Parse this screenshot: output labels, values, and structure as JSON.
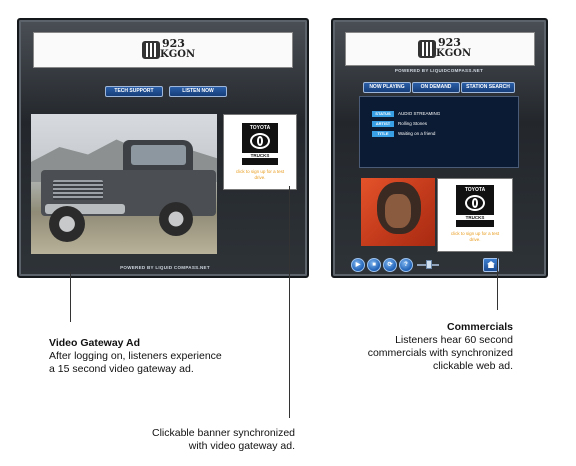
{
  "left_player": {
    "logo": {
      "number": "923",
      "name": "KGON"
    },
    "buttons": [
      "TECH SUPPORT",
      "LISTEN NOW"
    ],
    "ad": {
      "brand": "TOYOTA",
      "product": "TRUCKS",
      "link_text": "click to sign up for a test drive."
    },
    "footer": "POWERED BY LIQUID COMPASS.NET"
  },
  "right_player": {
    "logo": {
      "number": "923",
      "name": "KGON"
    },
    "powered": "POWERED BY LIQUIDCOMPASS.NET",
    "tabs": [
      "NOW PLAYING",
      "ON DEMAND",
      "STATION SEARCH"
    ],
    "info_rows": [
      {
        "label": "STATUS",
        "value": "AUDIO STREAMING"
      },
      {
        "label": "ARTIST",
        "value": "Rolling Stones"
      },
      {
        "label": "TITLE",
        "value": "Waiting on a friend"
      }
    ],
    "ad": {
      "brand": "TOYOTA",
      "product": "TRUCKS",
      "link_text": "click to sign up for a test drive."
    },
    "controls": [
      "play-icon",
      "stop-icon",
      "refresh-icon",
      "help-icon",
      "volume-slider",
      "home-icon"
    ],
    "control_glyphs": {
      "play": "▶",
      "stop": "■",
      "refresh": "⟳",
      "help": "?"
    }
  },
  "annotations": {
    "video_ad": {
      "title": "Video Gateway Ad",
      "lines": [
        "After logging on, listeners experience",
        "a 15 second video gateway ad."
      ]
    },
    "commercials": {
      "title": "Commercials",
      "lines": [
        "Listeners hear 60 second",
        "commercials with synchronized",
        "clickable web ad."
      ]
    },
    "banner": {
      "lines": [
        "Clickable banner synchronized",
        "with video gateway ad."
      ]
    }
  }
}
